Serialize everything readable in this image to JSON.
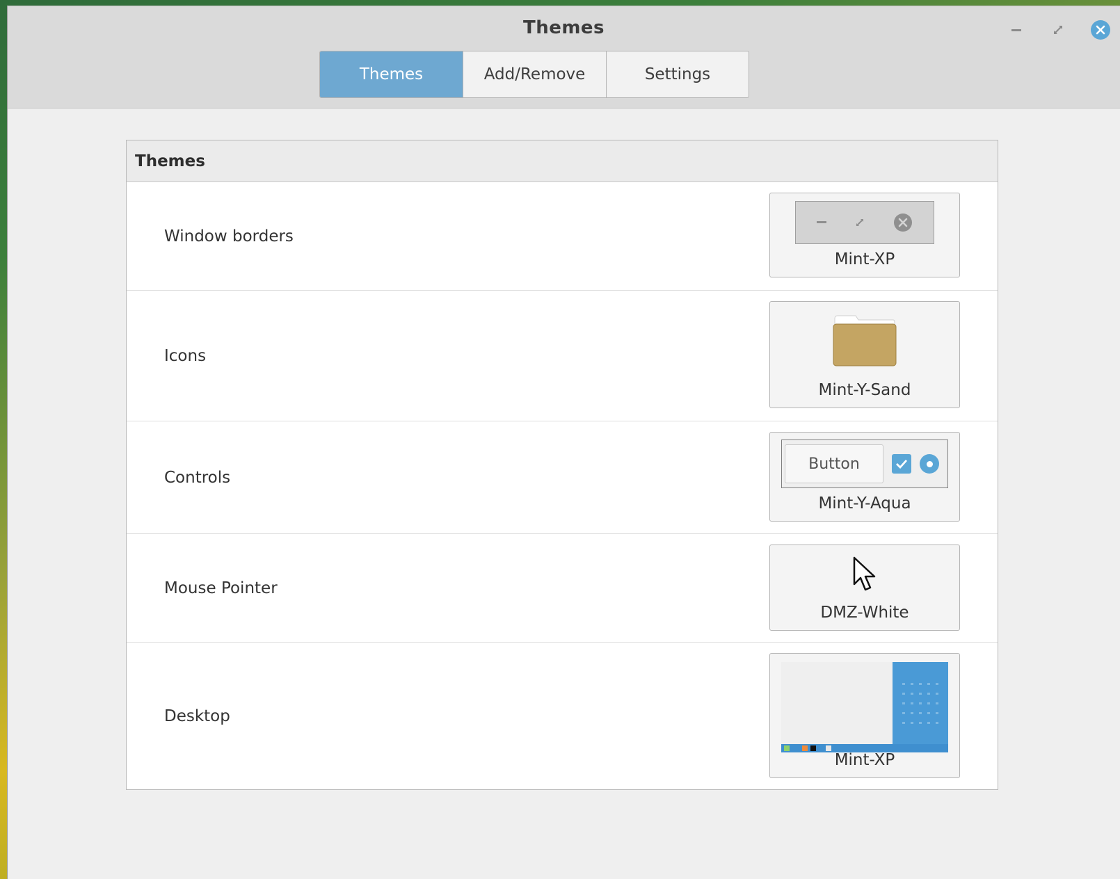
{
  "window": {
    "title": "Themes",
    "controls": [
      "minimize-icon",
      "maximize-icon",
      "close-icon"
    ],
    "accent_color": "#5aa6d6"
  },
  "tabs": [
    {
      "label": "Themes",
      "active": true
    },
    {
      "label": "Add/Remove",
      "active": false
    },
    {
      "label": "Settings",
      "active": false
    }
  ],
  "panel": {
    "header": "Themes",
    "rows": [
      {
        "label": "Window borders",
        "value": "Mint-XP",
        "preview_icon": "window-buttons-preview-icon"
      },
      {
        "label": "Icons",
        "value": "Mint-Y-Sand",
        "preview_icon": "folder-icon",
        "folder_color": "#c4a563"
      },
      {
        "label": "Controls",
        "value": "Mint-Y-Aqua",
        "preview_icon": "controls-preview-icon",
        "button_text": "Button"
      },
      {
        "label": "Mouse Pointer",
        "value": "DMZ-White",
        "preview_icon": "mouse-pointer-icon"
      },
      {
        "label": "Desktop",
        "value": "Mint-XP",
        "preview_icon": "desktop-preview-icon"
      }
    ]
  }
}
